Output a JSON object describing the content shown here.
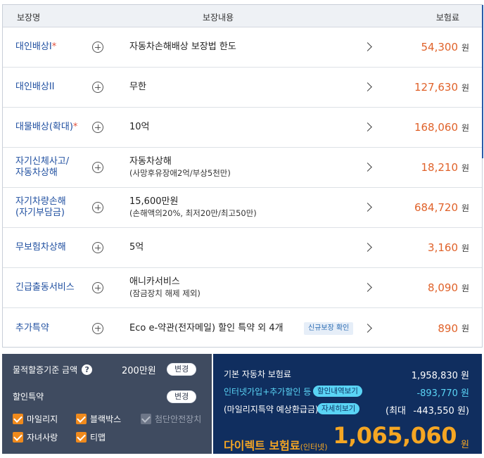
{
  "table": {
    "headers": {
      "name": "보장명",
      "content": "보장내용",
      "premium": "보험료"
    },
    "won": "원",
    "rows": [
      {
        "name": "대인배상I",
        "star": "*",
        "content": "자동차손해배상 보장법 한도",
        "sub": "",
        "amount": "54,300"
      },
      {
        "name": "대인배상II",
        "star": "",
        "content": "무한",
        "sub": "",
        "amount": "127,630"
      },
      {
        "name": "대물배상(확대)",
        "star": "*",
        "content": "10억",
        "sub": "",
        "amount": "168,060"
      },
      {
        "name": "자기신체사고/\n자동차상해",
        "star": "",
        "content": "자동차상해",
        "sub": "(사망후유장애2억/부상5천만)",
        "amount": "18,210"
      },
      {
        "name": "자기차량손해\n(자기부담금)",
        "star": "",
        "content": "15,600만원",
        "sub": "(손해액의20%, 최저20만/최고50만)",
        "amount": "684,720"
      },
      {
        "name": "무보험차상해",
        "star": "",
        "content": "5억",
        "sub": "",
        "amount": "3,160"
      },
      {
        "name": "긴급출동서비스",
        "star": "",
        "content": "애니카서비스",
        "sub": "(잠금장치 해제 제외)",
        "amount": "8,090"
      },
      {
        "name": "추가특약",
        "star": "",
        "content": "Eco e-약관(전자메일) 할인 특약 외 4개",
        "sub": "",
        "amount": "890",
        "badge": "신규보장 확인"
      }
    ]
  },
  "left_panel": {
    "property_label": "물적할증기준 금액",
    "property_value": "200만원",
    "change_label": "변경",
    "discount_title": "할인특약",
    "checkboxes": [
      {
        "label": "마일리지",
        "checked": true,
        "disabled": false
      },
      {
        "label": "블랙박스",
        "checked": true,
        "disabled": false
      },
      {
        "label": "첨단안전장치",
        "checked": true,
        "disabled": true
      },
      {
        "label": "자녀사랑",
        "checked": true,
        "disabled": false
      },
      {
        "label": "티맵",
        "checked": true,
        "disabled": false
      }
    ]
  },
  "right_panel": {
    "base_label": "기본 자동차 보험료",
    "base_value": "1,958,830 원",
    "discount_label": "인터넷가입+추가할인 등",
    "discount_tag": "할인내역보기",
    "discount_value": "-893,770 원",
    "mileage_label": "(마일리지특약 예상환급금)",
    "mileage_tag": "자세히보기",
    "mileage_value_prefix": "(최대",
    "mileage_value": "-443,550 원)",
    "final_label": "다이렉트 보험료",
    "final_label_small": "(인터넷)",
    "final_amount": "1,065,060",
    "final_won": "원"
  },
  "colors": {
    "accent_orange": "#e0622a",
    "final_orange": "#f5a623",
    "navy": "#102e5f",
    "cyan": "#5ad4f5",
    "link_blue": "#1f4fa0"
  }
}
